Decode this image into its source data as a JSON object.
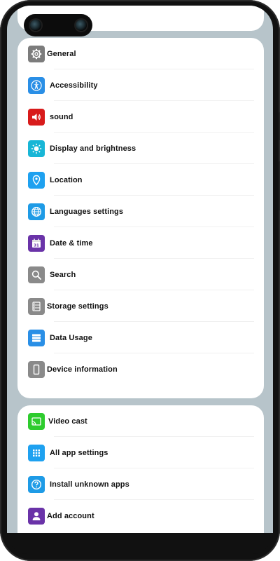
{
  "colors": {
    "background": "#b7c4ca",
    "card": "#ffffff",
    "general": "#7c7c7c",
    "accessibility": "#2a8fe6",
    "sound": "#d81b1b",
    "display": "#18b6d6",
    "location": "#1ea1f0",
    "languages": "#1e9be6",
    "date": "#6a33a8",
    "search": "#8a8a8a",
    "storage": "#8a8a8a",
    "data_usage": "#2a8fe6",
    "device": "#8a8a8a",
    "video_cast": "#2ecc2e",
    "all_apps": "#1ea1f0",
    "unknown_apps": "#1e9be6",
    "account": "#6a33a8"
  },
  "settings_group": {
    "items": [
      {
        "label": "General",
        "icon": "gear-icon"
      },
      {
        "label": "Accessibility",
        "icon": "accessibility-icon"
      },
      {
        "label": "sound",
        "icon": "speaker-icon"
      },
      {
        "label": "Display and brightness",
        "icon": "sun-icon"
      },
      {
        "label": "Location",
        "icon": "location-pin-icon"
      },
      {
        "label": "Languages settings",
        "icon": "globe-icon"
      },
      {
        "label": "Date & time",
        "icon": "calendar-icon",
        "calendar_day": "31"
      },
      {
        "label": "Search",
        "icon": "search-icon"
      },
      {
        "label": "Storage settings",
        "icon": "storage-icon"
      },
      {
        "label": "Data Usage",
        "icon": "data-usage-icon"
      },
      {
        "label": "Device information",
        "icon": "phone-icon"
      }
    ]
  },
  "apps_group": {
    "items": [
      {
        "label": "Video cast",
        "icon": "cast-icon"
      },
      {
        "label": "All app settings",
        "icon": "grid-icon"
      },
      {
        "label": "Install unknown apps",
        "icon": "question-icon"
      },
      {
        "label": "Add account",
        "icon": "person-icon"
      }
    ]
  }
}
